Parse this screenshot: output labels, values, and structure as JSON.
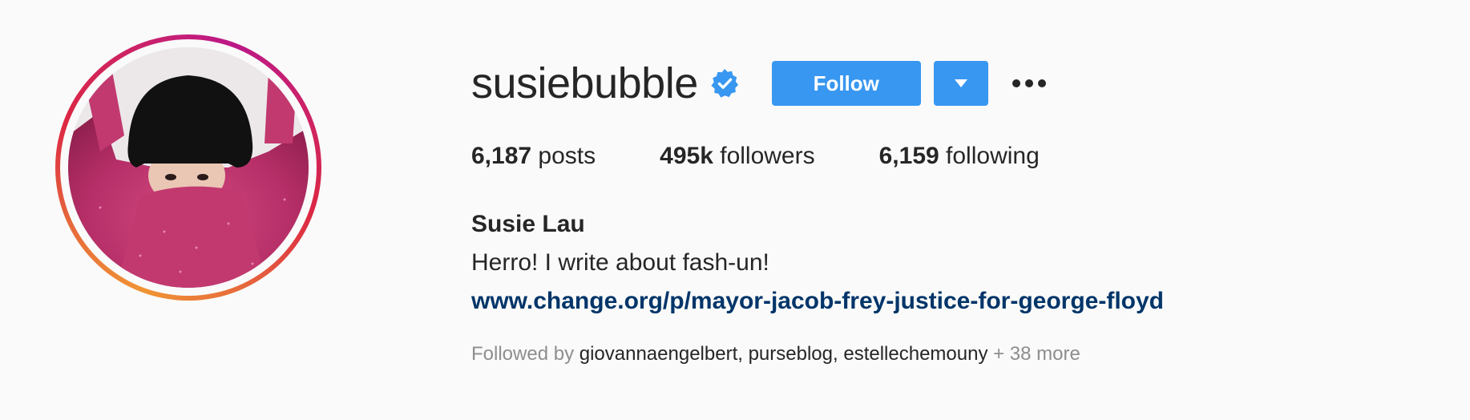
{
  "profile": {
    "username": "susiebubble",
    "verified_icon": "verified-badge-icon",
    "follow_label": "Follow",
    "dropdown_icon": "caret-down-icon",
    "more_icon": "more-options-icon",
    "full_name": "Susie Lau",
    "bio": "Herro! I write about fash-un!",
    "link": "www.change.org/p/mayor-jacob-frey-justice-for-george-floyd"
  },
  "stats": [
    {
      "count": "6,187",
      "label": "posts"
    },
    {
      "count": "495k",
      "label": "followers"
    },
    {
      "count": "6,159",
      "label": "following"
    }
  ],
  "followed_by": {
    "prefix": "Followed by",
    "names": [
      "giovannaengelbert",
      "purseblog",
      "estellechemouny"
    ],
    "more": "+ 38 more"
  },
  "colors": {
    "accent": "#3897f0",
    "verified": "#3897f0",
    "link": "#003569",
    "muted": "#8e8e8e"
  }
}
